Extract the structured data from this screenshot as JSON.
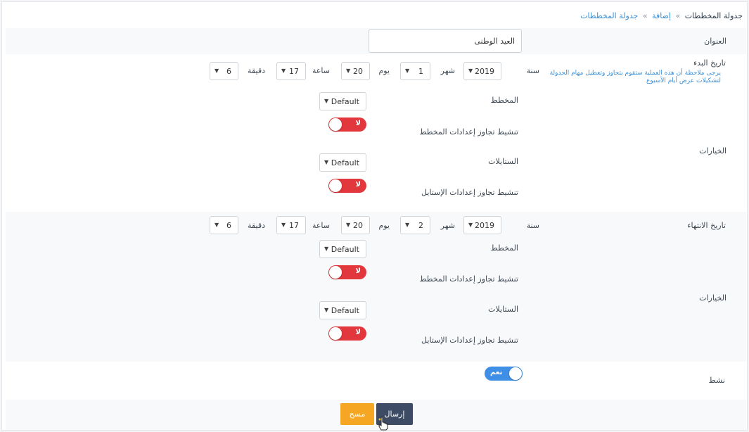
{
  "breadcrumb": {
    "current": "جدولة المخططات",
    "separator": "»",
    "add": "إضافة",
    "parent": "جدولة المخططات"
  },
  "form": {
    "title_label": "العنوان",
    "title_value": "العيد الوطنى",
    "start_label": "تاريخ البدء",
    "start_note": "يرجى ملاحظة أن هذه العملية ستقوم بتجاوز وتعطيل مهام الجدولة لتشكيلات عرض أيام الأسبوع",
    "end_label": "تاريخ الانتهاء",
    "options_label": "الخيارات",
    "active_label": "نشط"
  },
  "date_units": {
    "year": "سنة",
    "month": "شهر",
    "day": "يوم",
    "hour": "ساعة",
    "minute": "دقيقة"
  },
  "start_date": {
    "year": "2019",
    "month": "1",
    "day": "20",
    "hour": "17",
    "minute": "6"
  },
  "end_date": {
    "year": "2019",
    "month": "2",
    "day": "20",
    "hour": "17",
    "minute": "6"
  },
  "start_options": {
    "layout_label": "المخطط",
    "layout_value": "Default",
    "override_layout_label": "تنشيط تجاوز إعدادات المخطط",
    "override_layout_toggle": "لا",
    "styles_label": "الستايلات",
    "styles_value": "Default",
    "override_style_label": "تنشيط تجاوز إعدادات الإستايل",
    "override_style_toggle": "لا"
  },
  "end_options": {
    "layout_label": "المخطط",
    "layout_value": "Default",
    "override_layout_label": "تنشيط تجاوز إعدادات المخطط",
    "override_layout_toggle": "لا",
    "styles_label": "الستايلات",
    "styles_value": "Default",
    "override_style_label": "تنشيط تجاوز إعدادات الإستايل",
    "override_style_toggle": "لا"
  },
  "active_toggle": "نعم",
  "buttons": {
    "clear": "مسح",
    "submit": "إرسال"
  },
  "icons": {
    "dropdown": "chevron-down-icon",
    "cursor": "hand-pointer-icon"
  },
  "colors": {
    "toggle_off": "#e2373c",
    "toggle_on": "#3f8fe6",
    "submit": "#3d4b64",
    "clear": "#f5a623",
    "link": "#3a8fd5"
  }
}
